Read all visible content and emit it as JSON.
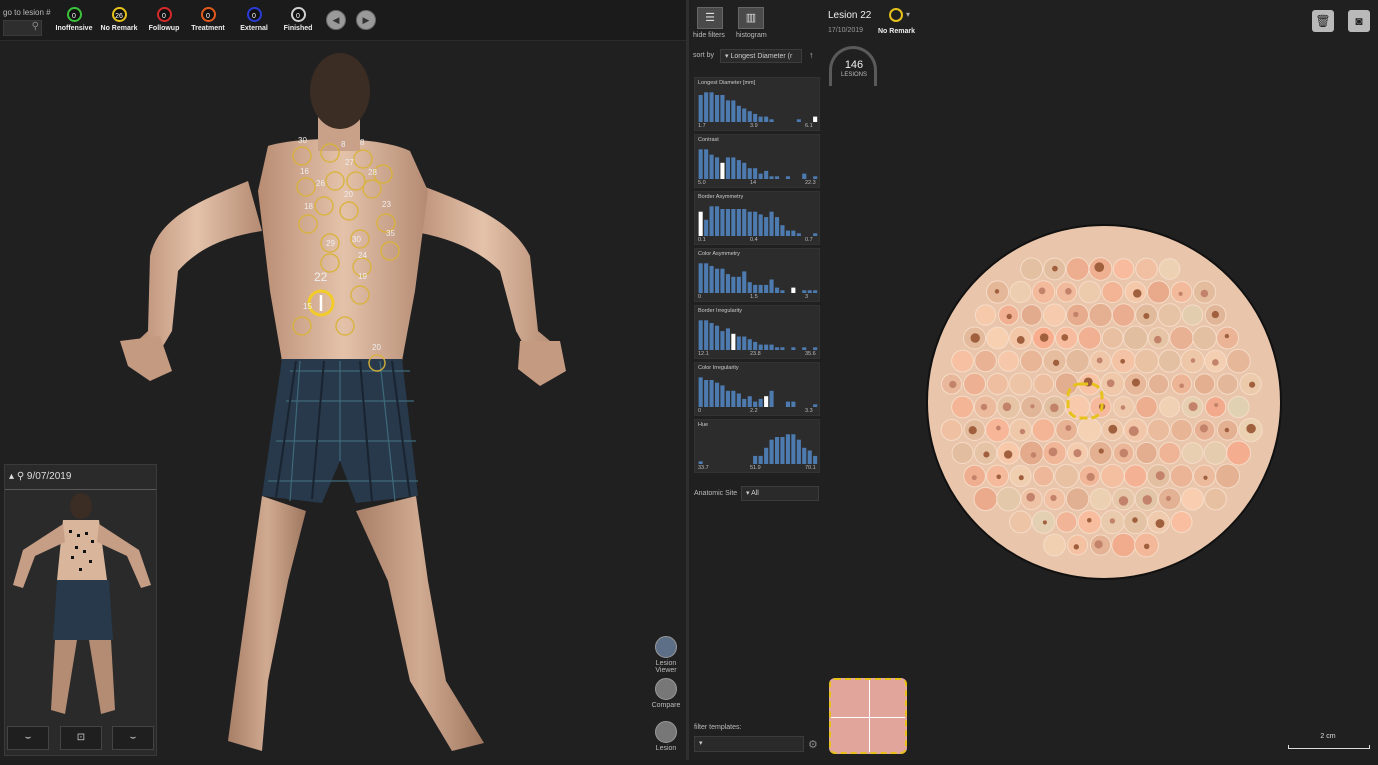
{
  "goto": {
    "label": "go to lesion #",
    "placeholder": ""
  },
  "statuses": [
    {
      "count": "0",
      "label": "Inoffensive",
      "color": "#3cc23c"
    },
    {
      "count": "26",
      "label": "No Remark",
      "color": "#e6c21b"
    },
    {
      "count": "0",
      "label": "Followup",
      "color": "#d52a2a"
    },
    {
      "count": "0",
      "label": "Treatment",
      "color": "#e25a1b"
    },
    {
      "count": "0",
      "label": "External",
      "color": "#2a3cd6"
    },
    {
      "count": "0",
      "label": "Finished",
      "color": "#d0d0d0"
    }
  ],
  "nav": {
    "prev": "◀",
    "next": "▶"
  },
  "body_markers": [
    "30",
    "8",
    "8",
    "16",
    "27",
    "26",
    "28",
    "18",
    "20",
    "23",
    "29",
    "35",
    "30",
    "22",
    "24",
    "19",
    "15",
    "20"
  ],
  "thumbnail": {
    "date": "9/07/2019"
  },
  "left_tools": [
    {
      "label1": "Lesion",
      "label2": "Viewer"
    },
    {
      "label1": "Compare",
      "label2": ""
    },
    {
      "label1": "Lesion",
      "label2": ""
    }
  ],
  "right": {
    "hide_filters": "hide filters",
    "histogram": "histogram",
    "lesion_title": "Lesion 22",
    "lesion_date": "17/10/2019",
    "lesion_status": "No Remark",
    "sort_by_label": "sort by",
    "sort_by_value": "Longest Diameter (r",
    "lesion_count": "146",
    "lesion_count_label": "LESIONS",
    "anatomic_label": "Anatomic Site",
    "anatomic_value": "All",
    "filter_templates": "filter templates:",
    "scale_label": "2 cm"
  },
  "histograms": [
    {
      "title": "Longest Diameter [mm]",
      "ticks": [
        "1.7",
        "3.9",
        "6.1"
      ],
      "bars": [
        10,
        11,
        11,
        10,
        10,
        8,
        8,
        6,
        5,
        4,
        3,
        2,
        2,
        1,
        0,
        0,
        0,
        0,
        1,
        0,
        0,
        2
      ],
      "highlight": 21
    },
    {
      "title": "Contrast",
      "ticks": [
        "5.0",
        "14",
        "22.3"
      ],
      "bars": [
        11,
        11,
        9,
        8,
        6,
        8,
        8,
        7,
        6,
        4,
        4,
        2,
        3,
        1,
        1,
        0,
        1,
        0,
        0,
        2,
        0,
        1
      ],
      "highlight": 4
    },
    {
      "title": "Border Asymmetry",
      "ticks": [
        "0.1",
        "0.4",
        "0.7"
      ],
      "bars": [
        9,
        6,
        11,
        11,
        10,
        10,
        10,
        10,
        10,
        9,
        9,
        8,
        7,
        9,
        7,
        4,
        2,
        2,
        1,
        0,
        0,
        1
      ],
      "highlight": 0
    },
    {
      "title": "Color Asymmetry",
      "ticks": [
        "0",
        "1.5",
        "3"
      ],
      "bars": [
        11,
        11,
        10,
        9,
        9,
        7,
        6,
        6,
        8,
        4,
        3,
        3,
        3,
        5,
        2,
        1,
        0,
        2,
        0,
        1,
        1,
        1
      ],
      "highlight": 17
    },
    {
      "title": "Border Irregularity",
      "ticks": [
        "12.1",
        "23.8",
        "35.6"
      ],
      "bars": [
        11,
        11,
        10,
        9,
        7,
        8,
        6,
        5,
        5,
        4,
        3,
        2,
        2,
        2,
        1,
        1,
        0,
        1,
        0,
        1,
        0,
        1
      ],
      "highlight": 6
    },
    {
      "title": "Color Irregularity",
      "ticks": [
        "0",
        "2.2",
        "3.3"
      ],
      "bars": [
        11,
        10,
        10,
        9,
        8,
        6,
        6,
        5,
        3,
        4,
        2,
        3,
        4,
        6,
        0,
        0,
        2,
        2,
        0,
        0,
        0,
        1
      ],
      "highlight": 12
    },
    {
      "title": "Hue",
      "ticks": [
        "33.7",
        "51.9",
        "70.1"
      ],
      "bars": [
        1,
        0,
        0,
        0,
        0,
        0,
        0,
        0,
        0,
        0,
        3,
        3,
        6,
        9,
        10,
        10,
        11,
        11,
        9,
        6,
        5,
        3
      ],
      "highlight": 9
    }
  ],
  "colors": {
    "accent": "#e6c21b",
    "bar": "#4d7bb0",
    "highlight": "#ffffff",
    "skin": "#e0b89d"
  }
}
